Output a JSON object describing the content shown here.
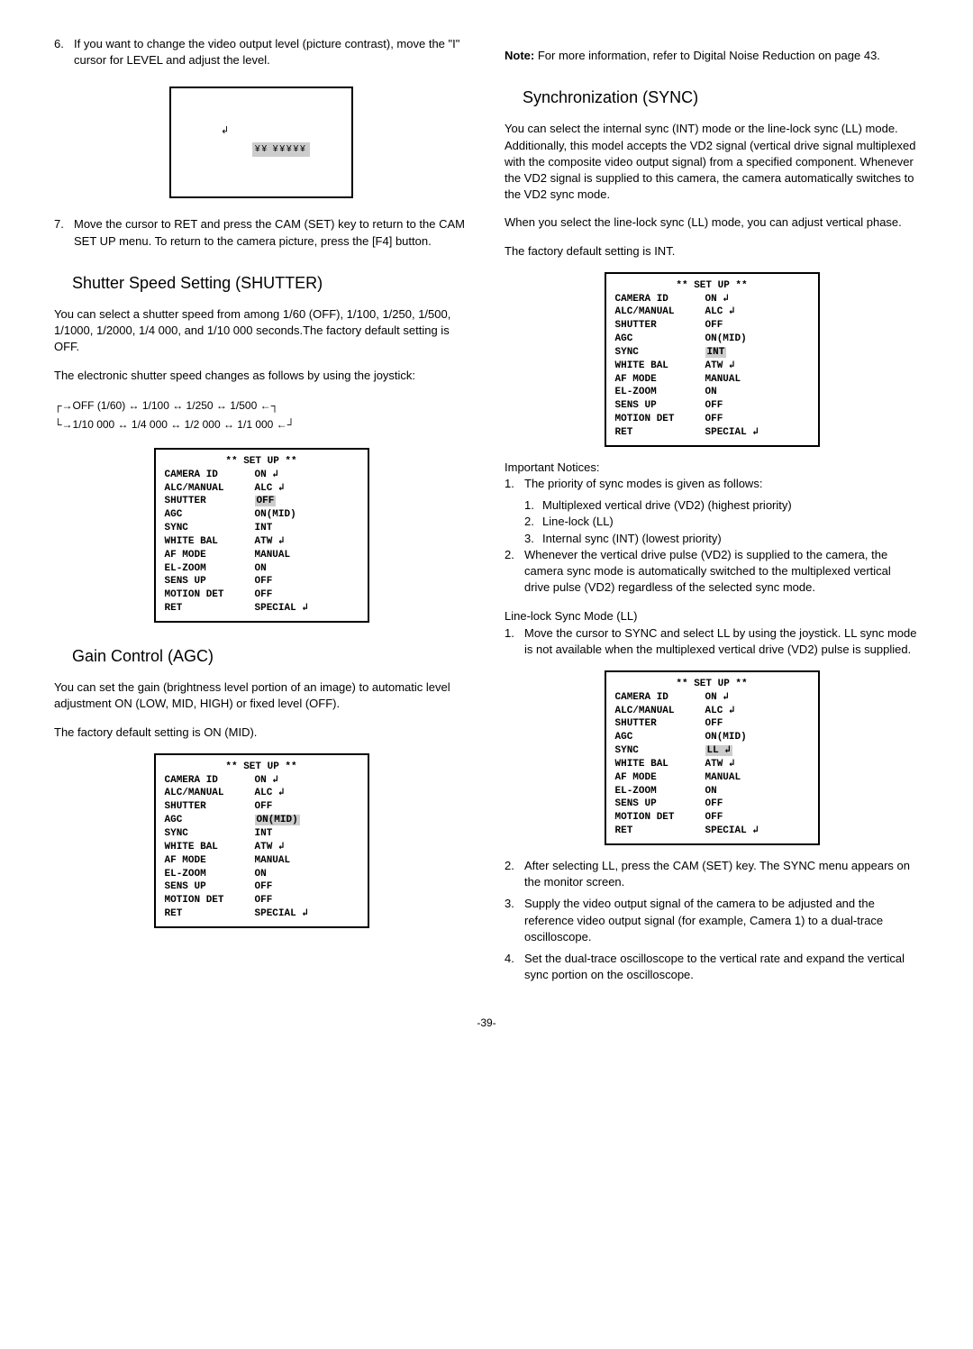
{
  "left": {
    "item6": "If you want to change the video output level (picture contrast), move the \"I\" cursor for LEVEL and adjust the level.",
    "levelBox": {
      "cursor": "↲",
      "bar": "¥¥ ¥¥¥¥¥"
    },
    "item7": "Move the cursor to RET and press the CAM (SET) key to return to the CAM SET UP menu. To return to the camera picture, press the [F4] button.",
    "shutterTitle": "Shutter Speed Setting (SHUTTER)",
    "shutterP1": "You can select a shutter speed from among 1/60 (OFF), 1/100, 1/250, 1/500, 1/1000, 1/2000, 1/4 000, and 1/10 000 seconds.The factory default setting is OFF.",
    "shutterP2": "The electronic shutter speed changes as follows by using the joystick:",
    "flowLine1": "OFF (1/60) ↔ 1/100 ↔ 1/250 ↔ 1/500",
    "flowLine2": "1/10 000 ↔ 1/4 000 ↔ 1/2 000 ↔ 1/1 000",
    "gainTitle": "Gain Control (AGC)",
    "gainP1": "You can set the gain (brightness level portion of an image) to automatic level adjustment ON (LOW, MID, HIGH) or fixed level (OFF).",
    "gainP2": "The factory default setting is ON (MID)."
  },
  "right": {
    "noteLabel": "Note:",
    "noteText": " For more information, refer to Digital Noise Reduction on page 43.",
    "syncTitle": "Synchronization (SYNC)",
    "syncP1": "You can select the internal sync (INT) mode or the line-lock sync (LL) mode. Additionally, this model accepts the VD2 signal (vertical drive signal multiplexed with the composite video output signal) from a specified component. Whenever the VD2 signal is supplied to this camera, the camera automatically switches to the VD2 sync mode.",
    "syncP2": "When you select the line-lock sync (LL) mode, you can adjust vertical phase.",
    "syncP3": "The factory default setting is INT.",
    "noticesTitle": "Important Notices:",
    "notice1": "The priority of sync modes is given as follows:",
    "notice1a": "Multiplexed vertical drive (VD2) (highest priority)",
    "notice1b": "Line-lock (LL)",
    "notice1c": "Internal sync (INT) (lowest priority)",
    "notice2": "Whenever the vertical drive pulse (VD2) is supplied to the camera, the camera sync mode is automatically switched to the multiplexed vertical drive pulse (VD2) regardless of the selected sync mode.",
    "llTitle": "Line-lock Sync Mode (LL)",
    "ll1": "Move the cursor to SYNC and select LL by using the joystick. LL sync mode is not available when the multiplexed vertical drive (VD2) pulse is supplied.",
    "ll2": "After selecting LL, press the CAM (SET) key. The SYNC menu appears on the monitor screen.",
    "ll3": "Supply the video output signal of the camera to be adjusted and the reference video output signal (for example, Camera 1) to a dual-trace oscilloscope.",
    "ll4": "Set the dual-trace oscilloscope to the vertical rate and expand the vertical sync portion on the oscilloscope."
  },
  "menus": {
    "title": "** SET UP **",
    "rows": [
      {
        "label": "CAMERA ID",
        "val": "ON ↲"
      },
      {
        "label": "ALC/MANUAL",
        "val": "ALC ↲"
      },
      {
        "label": "SHUTTER",
        "val": "OFF"
      },
      {
        "label": "AGC",
        "val": "ON(MID)"
      },
      {
        "label": "SYNC",
        "val": "INT"
      },
      {
        "label": "WHITE BAL",
        "val": "ATW ↲"
      },
      {
        "label": "AF MODE",
        "val": "MANUAL"
      },
      {
        "label": "EL-ZOOM",
        "val": "ON"
      },
      {
        "label": "SENS UP",
        "val": "OFF"
      },
      {
        "label": "MOTION DET",
        "val": "OFF"
      }
    ],
    "retRow": {
      "label": "RET",
      "val": "SPECIAL ↲"
    },
    "hlShutter": "OFF",
    "hlAgc": "ON(MID)",
    "hlSyncInt": "INT",
    "hlSyncLL": "LL ↲"
  },
  "pageNum": "-39-"
}
